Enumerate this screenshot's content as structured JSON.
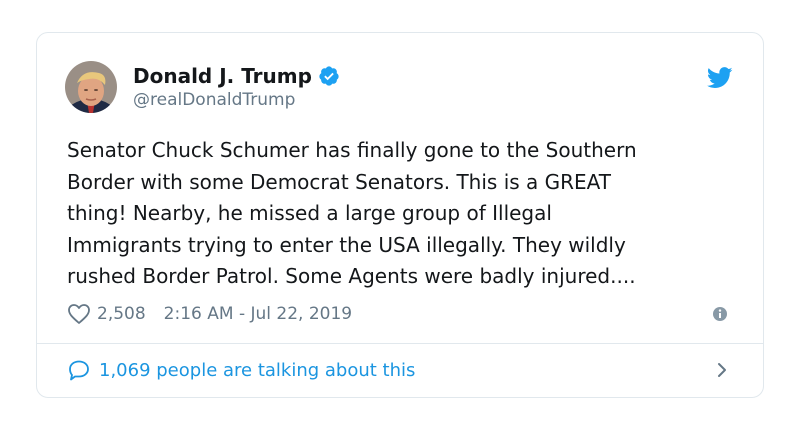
{
  "tweet": {
    "display_name": "Donald J. Trump",
    "handle": "@realDonaldTrump",
    "text": "Senator Chuck Schumer has finally gone to the Southern\nBorder with some Democrat Senators. This is a GREAT\nthing! Nearby, he missed a large group of Illegal\nImmigrants trying to enter the USA illegally. They wildly\nrushed Border Patrol. Some Agents were badly injured....",
    "likes": "2,508",
    "timestamp": "2:16 AM - Jul 22, 2019",
    "talking": "1,069 people are talking about this"
  },
  "icons": {
    "verified": "verified-badge-icon",
    "bird": "twitter-bird-icon",
    "heart": "heart-outline-icon",
    "info": "info-icon",
    "bubble": "speech-bubble-icon",
    "chevron": "chevron-right-icon"
  },
  "colors": {
    "accent": "#1da1f2",
    "link": "#1b95e0",
    "muted": "#657786",
    "text": "#14171a",
    "border": "#e1e8ed"
  }
}
